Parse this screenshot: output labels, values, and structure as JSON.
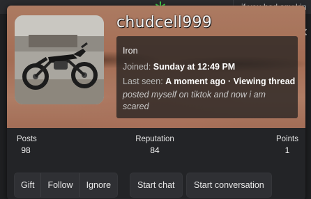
{
  "background": {
    "snippet_text": "if you had any kin",
    "close_icon": "close-icon",
    "decoration_icon": "snowflake-icon"
  },
  "profile": {
    "username": "chudcell999",
    "title": "Iron",
    "joined_label": "Joined:",
    "joined_value": "Sunday at 12:49 PM",
    "last_seen_label": "Last seen:",
    "last_seen_value": "A moment ago · Viewing thread",
    "status": "posted myself on tiktok and now i am scared",
    "avatar_description_icon": "dirt-bike-avatar"
  },
  "stats": {
    "posts_label": "Posts",
    "posts_value": "98",
    "reputation_label": "Reputation",
    "reputation_value": "84",
    "points_label": "Points",
    "points_value": "1"
  },
  "actions": {
    "gift": "Gift",
    "follow": "Follow",
    "ignore": "Ignore",
    "start_chat": "Start chat",
    "start_conversation": "Start conversation"
  },
  "colors": {
    "card_bg": "#232427",
    "button_bg": "#2f3034",
    "text": "#e8e8e8"
  }
}
